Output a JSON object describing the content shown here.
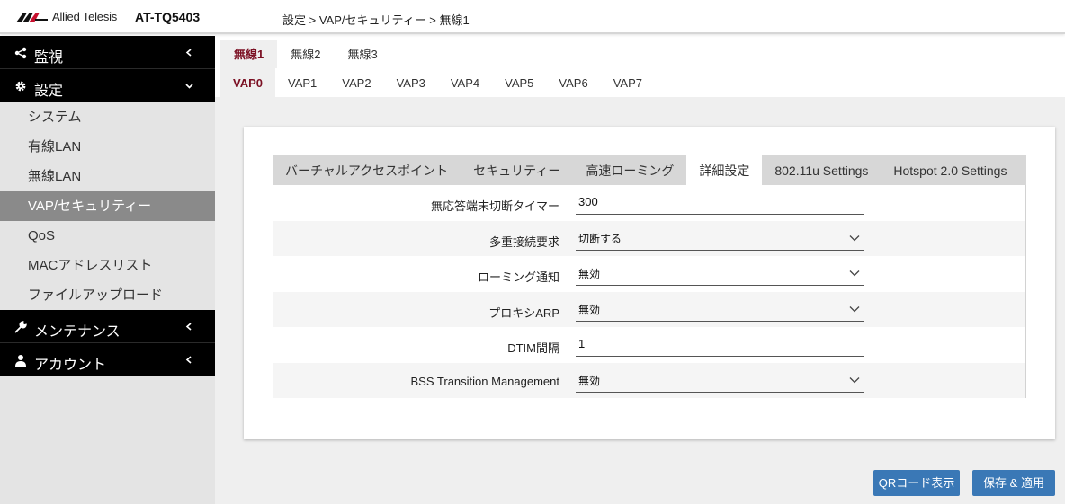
{
  "header": {
    "brand": "Allied Telesis",
    "model": "AT-TQ5403",
    "breadcrumb": "設定 > VAP/セキュリティー > 無線1"
  },
  "sidebar": {
    "groups": [
      {
        "label": "監視",
        "icon": "share-icon",
        "expanded": false
      },
      {
        "label": "設定",
        "icon": "gear-icon",
        "expanded": true
      },
      {
        "label": "メンテナンス",
        "icon": "wrench-icon",
        "expanded": false
      },
      {
        "label": "アカウント",
        "icon": "user-icon",
        "expanded": false
      }
    ],
    "items": [
      {
        "label": "システム"
      },
      {
        "label": "有線LAN"
      },
      {
        "label": "無線LAN"
      },
      {
        "label": "VAP/セキュリティー"
      },
      {
        "label": "QoS"
      },
      {
        "label": "MACアドレスリスト"
      },
      {
        "label": "ファイルアップロード"
      }
    ],
    "active_item": "VAP/セキュリティー"
  },
  "radio_tabs": [
    "無線1",
    "無線2",
    "無線3"
  ],
  "active_radio": "無線1",
  "vap_tabs": [
    "VAP0",
    "VAP1",
    "VAP2",
    "VAP3",
    "VAP4",
    "VAP5",
    "VAP6",
    "VAP7"
  ],
  "active_vap": "VAP0",
  "sub_tabs": [
    "バーチャルアクセスポイント",
    "セキュリティー",
    "高速ローミング",
    "詳細設定",
    "802.11u Settings",
    "Hotspot 2.0 Settings"
  ],
  "active_sub_tab": "詳細設定",
  "form": {
    "rows": [
      {
        "label": "無応答端末切断タイマー",
        "type": "text",
        "value": "300"
      },
      {
        "label": "多重接続要求",
        "type": "select",
        "value": "切断する"
      },
      {
        "label": "ローミング通知",
        "type": "select",
        "value": "無効"
      },
      {
        "label": "プロキシARP",
        "type": "select",
        "value": "無効"
      },
      {
        "label": "DTIM間隔",
        "type": "text",
        "value": "1"
      },
      {
        "label": "BSS Transition Management",
        "type": "select",
        "value": "無効"
      }
    ]
  },
  "buttons": {
    "qr": "QRコード表示",
    "save": "保存 & 適用"
  },
  "colors": {
    "accent_tab": "#7b1023",
    "button": "#3a78b6",
    "sidebar_active": "#8a8a8a",
    "nav_group_bg": "#000000"
  }
}
